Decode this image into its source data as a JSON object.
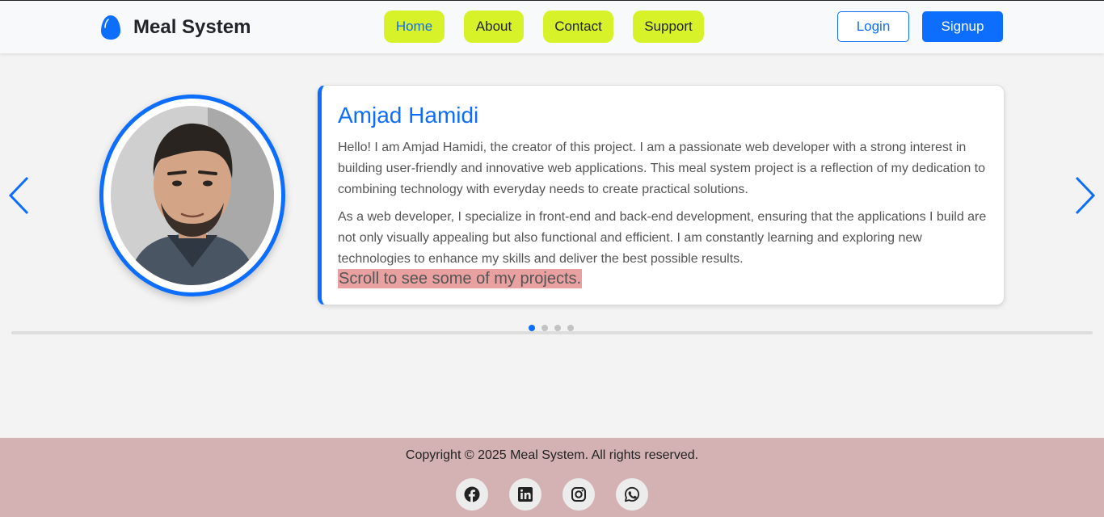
{
  "header": {
    "brand": "Meal System",
    "nav": [
      {
        "label": "Home",
        "active": true
      },
      {
        "label": "About",
        "active": false
      },
      {
        "label": "Contact",
        "active": false
      },
      {
        "label": "Support",
        "active": false
      }
    ],
    "login_label": "Login",
    "signup_label": "Signup"
  },
  "carousel": {
    "prev_icon": "chevron-left-icon",
    "next_icon": "chevron-right-icon",
    "slide": {
      "name": "Amjad Hamidi",
      "paragraph1": "Hello! I am Amjad Hamidi, the creator of this project. I am a passionate web developer with a strong interest in building user-friendly and innovative web applications. This meal system project is a reflection of my dedication to combining technology with everyday needs to create practical solutions.",
      "paragraph2": "As a web developer, I specialize in front-end and back-end development, ensuring that the applications I build are not only visually appealing but also functional and efficient. I am constantly learning and exploring new technologies to enhance my skills and deliver the best possible results.",
      "note": "Scroll to see some of my projects."
    },
    "slide_count": 4,
    "active_slide": 1
  },
  "footer": {
    "copyright": "Copyright © 2025 Meal System. All rights reserved.",
    "social": [
      "facebook-icon",
      "linkedin-icon",
      "instagram-icon",
      "whatsapp-icon"
    ]
  },
  "colors": {
    "accent": "#0d6efd",
    "nav_bg": "#d8f22a",
    "footer_bg": "#d4b2b4",
    "note_highlight": "#e8a0a0"
  }
}
